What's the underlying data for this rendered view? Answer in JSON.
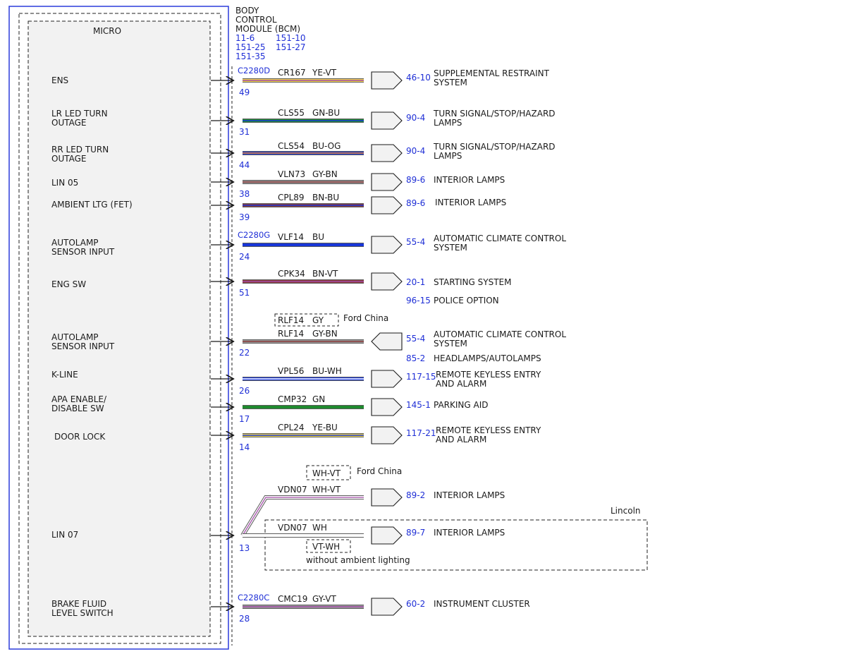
{
  "module": {
    "title_lines": [
      "BODY",
      "CONTROL",
      "MODULE (BCM)"
    ],
    "refs": [
      "11-6",
      "151-10",
      "151-25",
      "151-27",
      "151-35"
    ],
    "micro_label": "MICRO"
  },
  "colors": {
    "module_border": "#2b3bdc",
    "ref_blue": "#1f2fd6",
    "YE": "#f2d64b",
    "VT": "#a24aa8",
    "GN": "#1f8a2e",
    "BU": "#1836d8",
    "OG": "#f08a24",
    "GY": "#9a9a9a",
    "BN": "#8a3a3a",
    "WH": "#ffffff",
    "shadow": "#5c5c5c"
  },
  "circuits": [
    {
      "id": "c1",
      "input_lines": [
        "ENS"
      ],
      "connector": "C2280D",
      "pin": "49",
      "circuit": "CR167",
      "wire_color": "YE-VT",
      "refs": [
        "46-10"
      ],
      "dest_lines": [
        "SUPPLEMENTAL RESTRAINT",
        "SYSTEM"
      ]
    },
    {
      "id": "c2",
      "input_lines": [
        "LR LED TURN",
        "OUTAGE"
      ],
      "pin": "31",
      "circuit": "CLS55",
      "wire_color": "GN-BU",
      "refs": [
        "90-4"
      ],
      "dest_lines": [
        "TURN SIGNAL/STOP/HAZARD",
        "LAMPS"
      ]
    },
    {
      "id": "c3",
      "input_lines": [
        "RR LED TURN",
        "OUTAGE"
      ],
      "pin": "44",
      "circuit": "CLS54",
      "wire_color": "BU-OG",
      "refs": [
        "90-4"
      ],
      "dest_lines": [
        "TURN SIGNAL/STOP/HAZARD",
        "LAMPS"
      ]
    },
    {
      "id": "c4",
      "input_lines": [
        "LIN 05"
      ],
      "pin": "38",
      "circuit": "VLN73",
      "wire_color": "GY-BN",
      "refs": [
        "89-6"
      ],
      "dest_lines": [
        "INTERIOR LAMPS"
      ]
    },
    {
      "id": "c5",
      "input_lines": [
        "AMBIENT LTG (FET)"
      ],
      "pin": "39",
      "circuit": "CPL89",
      "wire_color": "BN-BU",
      "refs": [
        "89-6"
      ],
      "dest_lines": [
        "INTERIOR LAMPS"
      ]
    },
    {
      "id": "c6",
      "input_lines": [
        "AUTOLAMP",
        "SENSOR INPUT"
      ],
      "connector": "C2280G",
      "pin": "24",
      "circuit": "VLF14",
      "wire_color": "BU",
      "refs": [
        "55-4"
      ],
      "dest_lines": [
        "AUTOMATIC CLIMATE CONTROL",
        "SYSTEM"
      ]
    },
    {
      "id": "c7",
      "input_lines": [
        "ENG SW"
      ],
      "pin": "51",
      "circuit": "CPK34",
      "wire_color": "BN-VT",
      "refs": [
        "20-1"
      ],
      "dest_lines": [
        "STARTING SYSTEM"
      ],
      "extra_ref": "96-15",
      "extra_dest": "POLICE OPTION"
    },
    {
      "id": "c8",
      "input_lines": [
        "AUTOLAMP",
        "SENSOR INPUT"
      ],
      "pin": "22",
      "circuit": "RLF14",
      "wire_color": "GY-BN",
      "refs": [
        "55-4"
      ],
      "dest_lines": [
        "AUTOMATIC CLIMATE CONTROL",
        "SYSTEM"
      ],
      "extra_ref": "85-2",
      "extra_dest": "HEADLAMPS/AUTOLAMPS",
      "variant_box": {
        "circuit": "RLF14",
        "wire_color": "GY",
        "note": "Ford China"
      }
    },
    {
      "id": "c9",
      "input_lines": [
        "K-LINE"
      ],
      "pin": "26",
      "circuit": "VPL56",
      "wire_color": "BU-WH",
      "refs": [
        "117-15"
      ],
      "dest_lines": [
        "REMOTE KEYLESS ENTRY",
        "AND ALARM"
      ]
    },
    {
      "id": "c10",
      "input_lines": [
        "APA ENABLE/",
        "DISABLE SW"
      ],
      "pin": "17",
      "circuit": "CMP32",
      "wire_color": "GN",
      "refs": [
        "145-1"
      ],
      "dest_lines": [
        "PARKING AID"
      ]
    },
    {
      "id": "c11",
      "input_lines": [
        "DOOR LOCK"
      ],
      "pin": "14",
      "circuit": "CPL24",
      "wire_color": "YE-BU",
      "refs": [
        "117-21"
      ],
      "dest_lines": [
        "REMOTE KEYLESS ENTRY",
        "AND ALARM"
      ]
    },
    {
      "id": "c12",
      "input_lines": [
        "LIN 07"
      ],
      "pin": "13"
    },
    {
      "id": "c13",
      "input_lines": [
        "BRAKE FLUID",
        "LEVEL SWITCH"
      ],
      "connector": "C2280C",
      "pin": "28",
      "circuit": "CMC19",
      "wire_color": "GY-VT",
      "refs": [
        "60-2"
      ],
      "dest_lines": [
        "INSTRUMENT CLUSTER"
      ]
    }
  ],
  "lin07": {
    "branch_a": {
      "circuit": "VDN07",
      "wire_color": "WH-VT",
      "ref": "89-2",
      "dest": "INTERIOR LAMPS",
      "variant_wire_color": "WH-VT",
      "variant_note": "Ford China"
    },
    "branch_b": {
      "circuit": "VDN07",
      "wire_color": "WH",
      "ref": "89-7",
      "dest": "INTERIOR LAMPS",
      "variant_wire_color": "VT-WH",
      "variant_note": "without ambient lighting"
    },
    "region_label": "Lincoln"
  }
}
